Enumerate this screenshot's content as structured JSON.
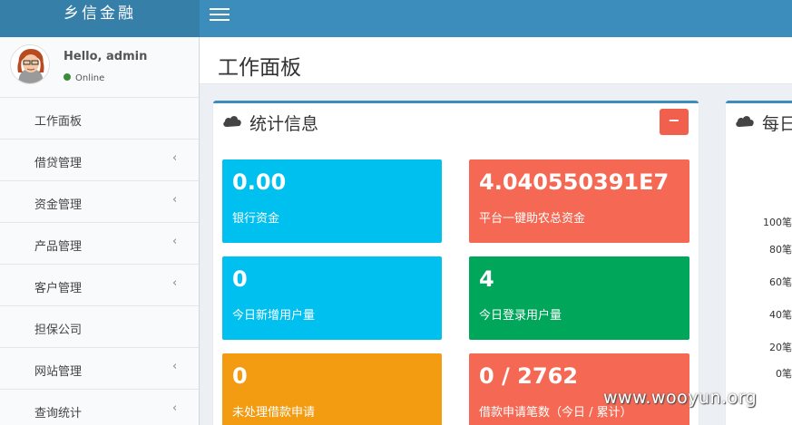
{
  "brand": {
    "title": "乡信金融"
  },
  "user": {
    "greeting": "Hello, admin",
    "status": "Online",
    "status_color": "#3c8a3c"
  },
  "sidebar": {
    "items": [
      {
        "label": "工作面板",
        "has_submenu": false
      },
      {
        "label": "借贷管理",
        "has_submenu": true
      },
      {
        "label": "资金管理",
        "has_submenu": true
      },
      {
        "label": "产品管理",
        "has_submenu": true
      },
      {
        "label": "客户管理",
        "has_submenu": true
      },
      {
        "label": "担保公司",
        "has_submenu": false
      },
      {
        "label": "网站管理",
        "has_submenu": true
      },
      {
        "label": "查询统计",
        "has_submenu": true
      }
    ],
    "chevron": "‹"
  },
  "page": {
    "title": "工作面板"
  },
  "stats_box": {
    "title": "统计信息",
    "collapse_label": "−",
    "cards": [
      {
        "value": "0.00",
        "label": "银行资金",
        "color": "#00c0ef"
      },
      {
        "value": "4.040550391E7",
        "label": "平台一键助农总资金",
        "color": "#f56954"
      },
      {
        "value": "0",
        "label": "今日新增用户量",
        "color": "#00c0ef"
      },
      {
        "value": "4",
        "label": "今日登录用户量",
        "color": "#00a65a"
      },
      {
        "value": "0",
        "label": "未处理借款申请",
        "color": "#f39c12"
      },
      {
        "value": "0 / 2762",
        "label": "借款申请笔数（今日 / 累计）",
        "color": "#f56954"
      }
    ]
  },
  "daily_box": {
    "title": "每日",
    "y_labels": [
      "100笔",
      "80笔",
      "60笔",
      "40笔",
      "20笔",
      "0笔"
    ]
  },
  "watermark": "www.wooyun.org",
  "colors": {
    "header": "#3c8dbc",
    "logo_bg": "#367fa9",
    "box_border": "#3c8dbc"
  }
}
